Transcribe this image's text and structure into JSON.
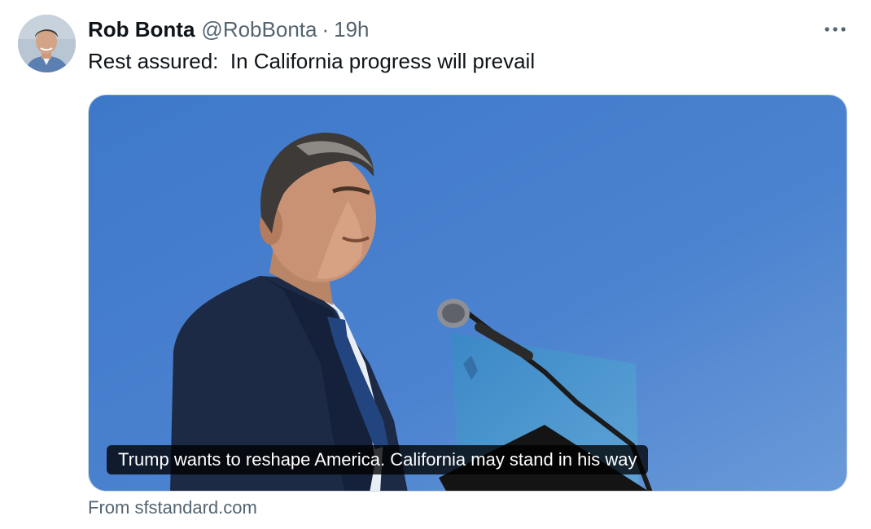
{
  "author": {
    "display_name": "Rob Bonta",
    "handle": "@RobBonta",
    "separator": "·",
    "timestamp": "19h"
  },
  "tweet": {
    "text": "Rest assured:  In California progress will prevail"
  },
  "link_card": {
    "headline": "Trump wants to reshape America. California may stand in his way",
    "source": "From sfstandard.com"
  },
  "icons": {
    "more": "more-options-icon",
    "avatar": "profile-avatar"
  },
  "colors": {
    "text_primary": "#0f1419",
    "text_secondary": "#536471",
    "sky": "#3f78c8"
  }
}
